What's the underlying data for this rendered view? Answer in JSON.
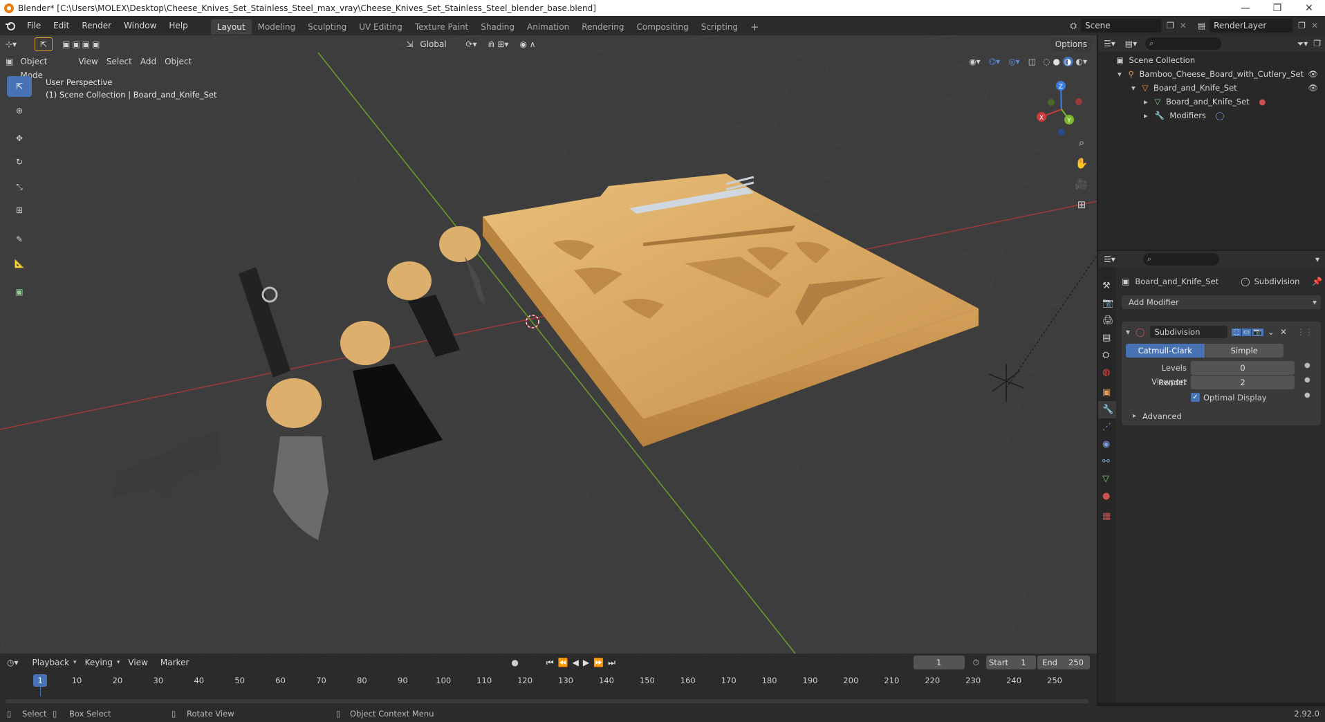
{
  "window": {
    "title": "Blender* [C:\\Users\\MOLEX\\Desktop\\Cheese_Knives_Set_Stainless_Steel_max_vray\\Cheese_Knives_Set_Stainless_Steel_blender_base.blend]",
    "minimize": "—",
    "maximize": "❐",
    "close": "✕"
  },
  "menubar": {
    "menus": [
      "File",
      "Edit",
      "Render",
      "Window",
      "Help"
    ],
    "workspaces": [
      "Layout",
      "Modeling",
      "Sculpting",
      "UV Editing",
      "Texture Paint",
      "Shading",
      "Animation",
      "Rendering",
      "Compositing",
      "Scripting"
    ],
    "active_workspace": "Layout",
    "add_workspace": "+",
    "scene": "Scene",
    "view_layer": "RenderLayer"
  },
  "viewport": {
    "mode": "Object Mode",
    "menus": [
      "View",
      "Select",
      "Add",
      "Object"
    ],
    "transform_orientation": "Global",
    "options": "Options",
    "overlay_line1": "User Perspective",
    "overlay_line2": "(1) Scene Collection | Board_and_Knife_Set",
    "gizmo": {
      "x": "X",
      "y": "Y",
      "z": "Z"
    }
  },
  "outliner": {
    "root": "Scene Collection",
    "rows": [
      {
        "label": "Bamboo_Cheese_Board_with_Cutlery_Set",
        "depth": 1
      },
      {
        "label": "Board_and_Knife_Set",
        "depth": 2
      },
      {
        "label": "Board_and_Knife_Set",
        "depth": 3
      },
      {
        "label": "Modifiers",
        "depth": 3
      }
    ]
  },
  "properties": {
    "object_name": "Board_and_Knife_Set",
    "modifier_tab": "Subdivision",
    "add_modifier": "Add Modifier",
    "modifier": {
      "name": "Subdivision",
      "type_options": [
        "Catmull-Clark",
        "Simple"
      ],
      "active_type": "Catmull-Clark",
      "levels_viewport_label": "Levels Viewport",
      "levels_viewport": "0",
      "render_label": "Render",
      "render": "2",
      "optimal_display_label": "Optimal Display",
      "optimal_display": true,
      "advanced": "Advanced"
    }
  },
  "timeline": {
    "menus": [
      "Playback",
      "Keying",
      "View",
      "Marker"
    ],
    "current_frame": "1",
    "start_label": "Start",
    "start": "1",
    "end_label": "End",
    "end": "250",
    "ticks": [
      "1",
      "10",
      "20",
      "30",
      "40",
      "50",
      "60",
      "70",
      "80",
      "90",
      "100",
      "110",
      "120",
      "130",
      "140",
      "150",
      "160",
      "170",
      "180",
      "190",
      "200",
      "210",
      "220",
      "230",
      "240",
      "250"
    ]
  },
  "statusbar": {
    "select": "Select",
    "box_select": "Box Select",
    "rotate_view": "Rotate View",
    "context_menu": "Object Context Menu",
    "version": "2.92.0"
  },
  "colors": {
    "accent": "#4772b3",
    "viewport_bg": "#3d3d3d",
    "x_axis": "#c83c3c",
    "y_axis": "#7fb82c",
    "z_axis": "#3a7fe0"
  }
}
